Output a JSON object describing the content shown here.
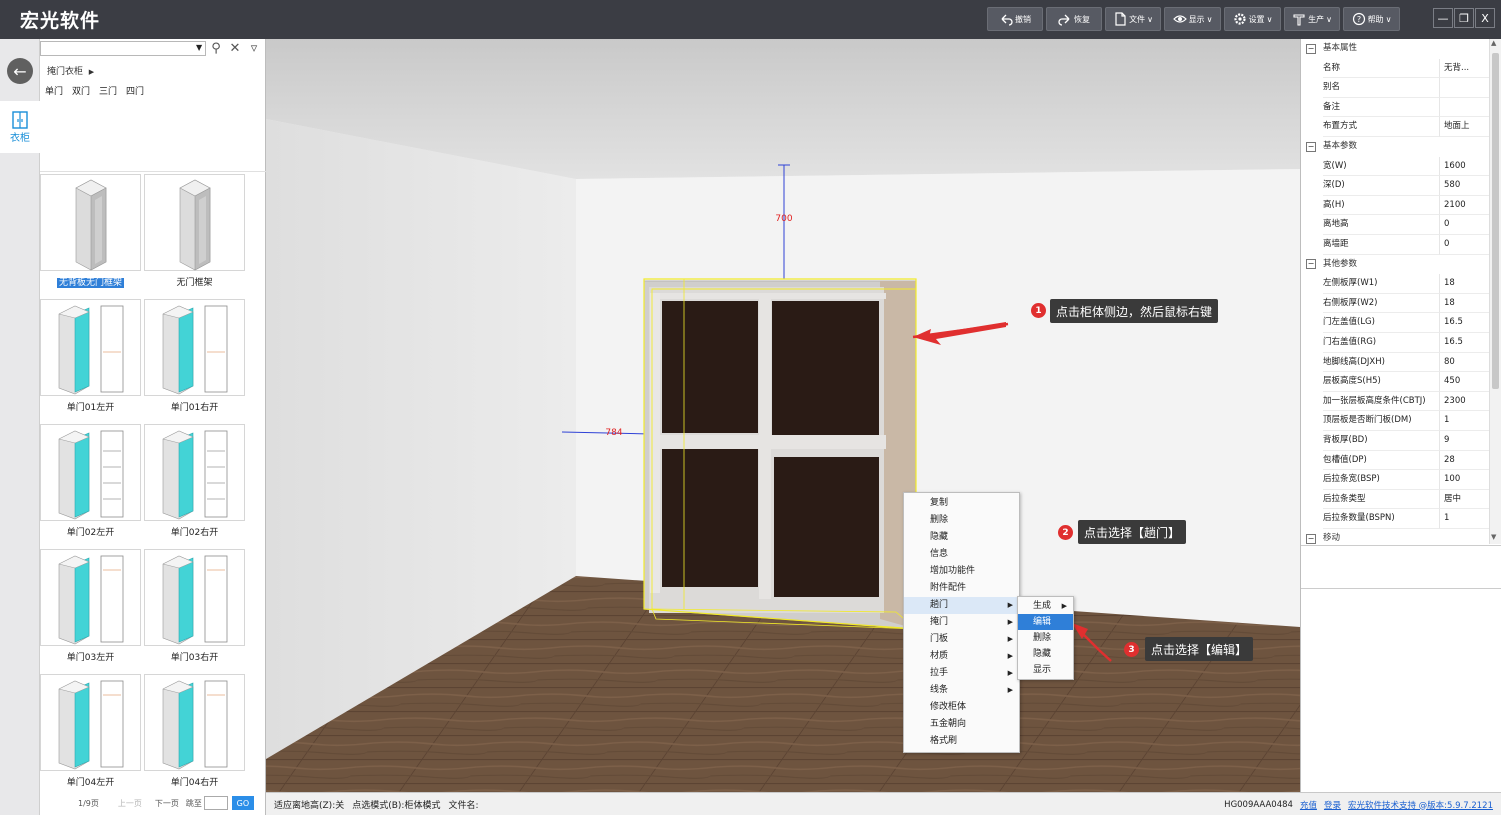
{
  "app": {
    "title": "宏光软件"
  },
  "toolbar": [
    {
      "key": "undo",
      "label": "撤销",
      "icon": "undo-icon",
      "dropdown": false
    },
    {
      "key": "redo",
      "label": "恢复",
      "icon": "redo-icon",
      "dropdown": false
    },
    {
      "key": "file",
      "label": "文件",
      "icon": "file-icon",
      "dropdown": true
    },
    {
      "key": "display",
      "label": "显示",
      "icon": "eye-icon",
      "dropdown": true
    },
    {
      "key": "settings",
      "label": "设置",
      "icon": "gear-icon",
      "dropdown": true
    },
    {
      "key": "produce",
      "label": "生产",
      "icon": "production-icon",
      "dropdown": true
    },
    {
      "key": "help",
      "label": "帮助",
      "icon": "help-icon",
      "dropdown": true
    }
  ],
  "window_controls": {
    "minimize": "—",
    "restore": "❐",
    "close": "X"
  },
  "rail": {
    "back_icon": "back-arrow-icon",
    "wardrobe_label": "衣柜"
  },
  "library": {
    "search_value": "",
    "path": "掩门衣柜",
    "categories": [
      "单门",
      "双门",
      "三门",
      "四门"
    ],
    "items": [
      {
        "label": "无背板无门框架",
        "selected": true,
        "kind": "frame"
      },
      {
        "label": "无门框架",
        "selected": false,
        "kind": "frame"
      },
      {
        "label": "单门01左开",
        "selected": false,
        "kind": "door",
        "hinge": "left",
        "layout": "shelf"
      },
      {
        "label": "单门01右开",
        "selected": false,
        "kind": "door",
        "hinge": "right",
        "layout": "shelf"
      },
      {
        "label": "单门02左开",
        "selected": false,
        "kind": "door",
        "hinge": "left",
        "layout": "drawers"
      },
      {
        "label": "单门02右开",
        "selected": false,
        "kind": "door",
        "hinge": "right",
        "layout": "drawers"
      },
      {
        "label": "单门03左开",
        "selected": false,
        "kind": "door",
        "hinge": "left",
        "layout": "rail"
      },
      {
        "label": "单门03右开",
        "selected": false,
        "kind": "door",
        "hinge": "right",
        "layout": "rail"
      },
      {
        "label": "单门04左开",
        "selected": false,
        "kind": "door",
        "hinge": "left",
        "layout": "rail"
      },
      {
        "label": "单门04右开",
        "selected": false,
        "kind": "door",
        "hinge": "right",
        "layout": "rail"
      }
    ],
    "pager": {
      "page": "1/9页",
      "prev": "上一页",
      "next": "下一页",
      "jump": "跳至",
      "go": "GO"
    }
  },
  "viewport": {
    "dim_height": "700",
    "dim_distance": "784",
    "colors": {
      "selection": "#f2ea2a",
      "door": "#2a1b15",
      "frame": "#d7d5d3",
      "floor": "#6b513c"
    }
  },
  "context_menu": {
    "items": [
      {
        "label": "复制",
        "has_sub": false
      },
      {
        "label": "删除",
        "has_sub": false
      },
      {
        "label": "隐藏",
        "has_sub": false
      },
      {
        "label": "信息",
        "has_sub": false
      },
      {
        "label": "增加功能件",
        "has_sub": false
      },
      {
        "label": "附件配件",
        "has_sub": false
      },
      {
        "label": "趟门",
        "has_sub": true,
        "highlighted": true
      },
      {
        "label": "掩门",
        "has_sub": true
      },
      {
        "label": "门板",
        "has_sub": true
      },
      {
        "label": "材质",
        "has_sub": true
      },
      {
        "label": "拉手",
        "has_sub": true
      },
      {
        "label": "线条",
        "has_sub": true
      },
      {
        "label": "修改柜体",
        "has_sub": false
      },
      {
        "label": "五金朝向",
        "has_sub": false
      },
      {
        "label": "格式刷",
        "has_sub": false
      }
    ],
    "submenu": [
      {
        "label": "生成",
        "has_sub": true
      },
      {
        "label": "编辑",
        "has_sub": false,
        "selected": true
      },
      {
        "label": "删除",
        "has_sub": false
      },
      {
        "label": "隐藏",
        "has_sub": false
      },
      {
        "label": "显示",
        "has_sub": false
      }
    ]
  },
  "annotations": [
    {
      "num": "1",
      "text": "点击柜体侧边，然后鼠标右键"
    },
    {
      "num": "2",
      "text": "点击选择【趟门】"
    },
    {
      "num": "3",
      "text": "点击选择【编辑】"
    }
  ],
  "properties": {
    "groups": [
      {
        "title": "基本属性",
        "rows": [
          {
            "name": "名称",
            "value": "无背..."
          },
          {
            "name": "别名",
            "value": ""
          },
          {
            "name": "备注",
            "value": ""
          },
          {
            "name": "布置方式",
            "value": "地面上"
          }
        ]
      },
      {
        "title": "基本参数",
        "rows": [
          {
            "name": "宽(W)",
            "value": "1600"
          },
          {
            "name": "深(D)",
            "value": "580"
          },
          {
            "name": "高(H)",
            "value": "2100"
          },
          {
            "name": "离地高",
            "value": "0"
          },
          {
            "name": "离墙距",
            "value": "0"
          }
        ]
      },
      {
        "title": "其他参数",
        "rows": [
          {
            "name": "左侧板厚(W1)",
            "value": "18"
          },
          {
            "name": "右侧板厚(W2)",
            "value": "18"
          },
          {
            "name": "门左盖值(LG)",
            "value": "16.5"
          },
          {
            "name": "门右盖值(RG)",
            "value": "16.5"
          },
          {
            "name": "地脚线高(DJXH)",
            "value": "80"
          },
          {
            "name": "层板高度S(H5)",
            "value": "450"
          },
          {
            "name": "加一张层板高度条件(CBTJ)",
            "value": "2300"
          },
          {
            "name": "顶层板是否断门板(DM)",
            "value": "1"
          },
          {
            "name": "背板厚(BD)",
            "value": "9"
          },
          {
            "name": "包槽值(DP)",
            "value": "28"
          },
          {
            "name": "后拉条宽(BSP)",
            "value": "100"
          },
          {
            "name": "后拉条类型",
            "value": "居中"
          },
          {
            "name": "后拉条数量(BSPN)",
            "value": "1"
          }
        ]
      },
      {
        "title": "移动",
        "rows": []
      }
    ]
  },
  "status": {
    "left": [
      "适应离地高(Z):关",
      "点选模式(B):柜体模式",
      "文件名:"
    ],
    "code": "HG009AAA0484",
    "recharge": "充值",
    "login": "登录",
    "support": "宏光软件技术支持 @版本:5.9.7.2121"
  }
}
